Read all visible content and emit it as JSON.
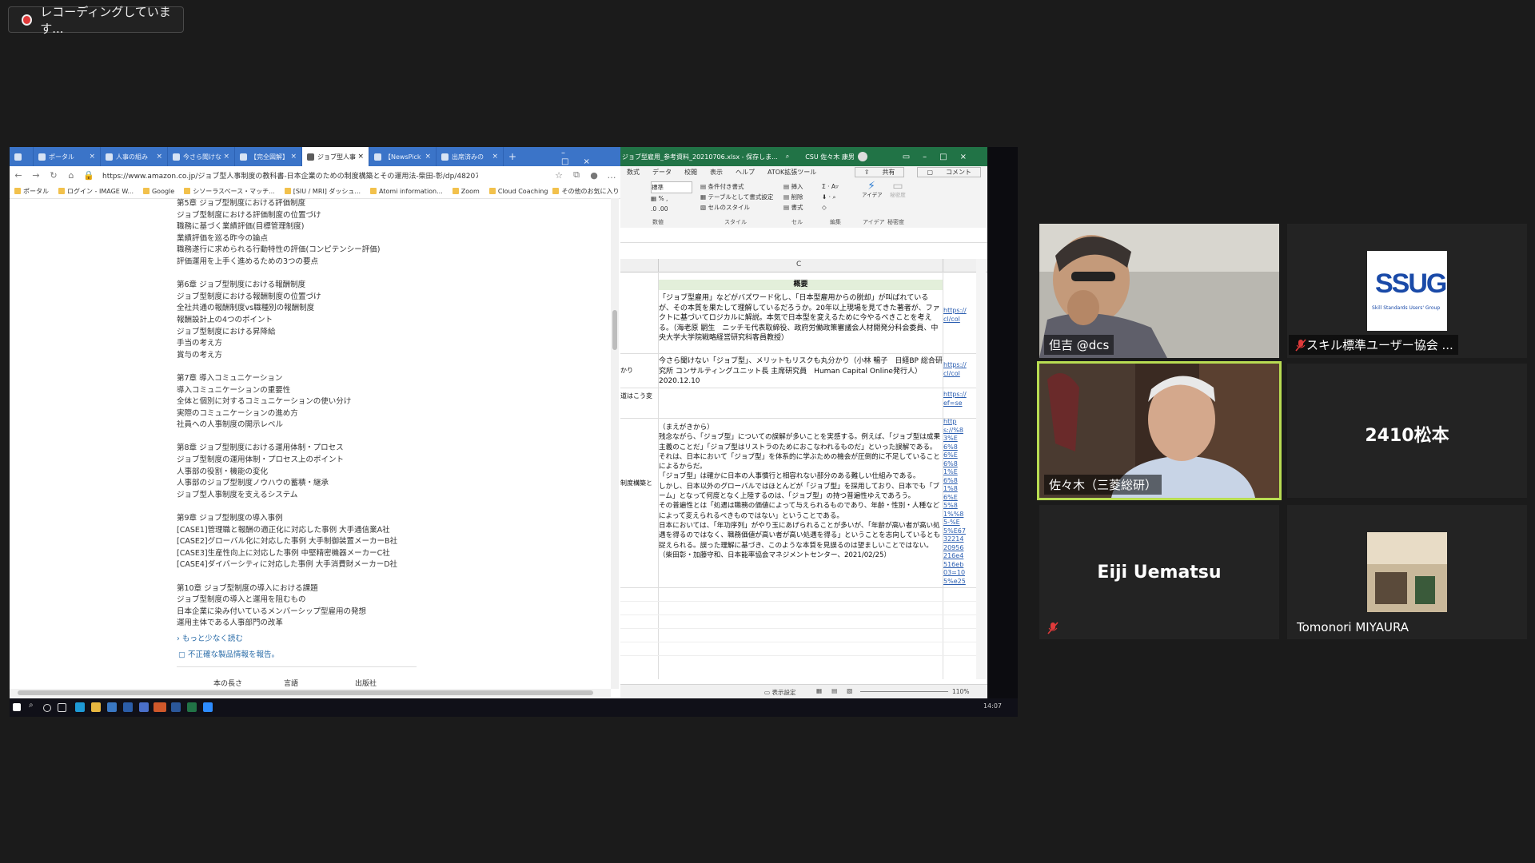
{
  "recording": {
    "label": "レコーディングしています..."
  },
  "browser": {
    "tabs": [
      "ポータル",
      "人事の組み",
      "今さら聞けな",
      "【完全図解】",
      "ジョブ型人事",
      "【NewsPick",
      "出席済みの"
    ],
    "url": "https://www.amazon.co.jp/ジョブ型人事制度の教科書-日本企業のための制度構築とその運用法-柴田-彰/dp/48207...",
    "bookmarks": [
      "ポータル",
      "ログイン - IMAGE W...",
      "Google",
      "シソーラスベース・マッチ...",
      "[SIU / MRI] ダッシュ...",
      "Atomi information...",
      "Zoom",
      "Cloud Coaching",
      "その他のお気に入り"
    ],
    "toc_lines": [
      "第5章 ジョブ型制度における評価制度",
      "ジョブ型制度における評価制度の位置づけ",
      "職務に基づく業績評価(目標管理制度)",
      "業績評価を巡る昨今の論点",
      "職務遂行に求められる行動特性の評価(コンピテンシー評価)",
      "評価運用を上手く進めるための3つの要点",
      "",
      "第6章 ジョブ型制度における報酬制度",
      "ジョブ型制度における報酬制度の位置づけ",
      "全社共通の報酬制度vs職種別の報酬制度",
      "報酬設計上の4つのポイント",
      "ジョブ型制度における昇降給",
      "手当の考え方",
      "賞与の考え方",
      "",
      "第7章 導入コミュニケーション",
      "導入コミュニケーションの重要性",
      "全体と個別に対するコミュニケーションの使い分け",
      "実際のコミュニケーションの進め方",
      "社員への人事制度の開示レベル",
      "",
      "第8章 ジョブ型制度における運用体制・プロセス",
      "ジョブ型制度の運用体制・プロセス上のポイント",
      "人事部の役割・機能の変化",
      "人事部のジョブ型制度ノウハウの蓄積・継承",
      "ジョブ型人事制度を支えるシステム",
      "",
      "第9章 ジョブ型制度の導入事例",
      "[CASE1]管理職と報酬の適正化に対応した事例 大手通信業A社",
      "[CASE2]グローバル化に対応した事例 大手制御装置メーカーB社",
      "[CASE3]生産性向上に対応した事例 中堅精密機器メーカーC社",
      "[CASE4]ダイバーシティに対応した事例 大手消費財メーカーD社",
      "",
      "第10章 ジョブ型制度の導入における課題",
      "ジョブ型制度の導入と運用を阻むもの",
      "日本企業に染み付いているメンバーシップ型雇用の発想",
      "運用主体である人事部門の改革"
    ],
    "read_less": "› もっと少なく読む",
    "report": "不正確な製品情報を報告。",
    "details_header": [
      "本の長さ",
      "言語",
      "出版社"
    ]
  },
  "excel": {
    "title": "ジョブ型雇用_参考資料_20210706.xlsx - 保存しま...",
    "user": "CSU 佐々木 康男",
    "menu": [
      "数式",
      "データ",
      "校閲",
      "表示",
      "ヘルプ",
      "ATOK拡張ツール"
    ],
    "share": "共有",
    "comment": "コメント",
    "ribbon": {
      "number_format": "標準",
      "style_items": [
        "条件付き書式",
        "テーブルとして書式設定",
        "セルのスタイル"
      ],
      "cell_items": [
        "挿入",
        "削除",
        "書式"
      ],
      "idea": "アイデア",
      "sensitivity": "秘密度",
      "groups": [
        "数値",
        "スタイル",
        "セル",
        "編集",
        "アイデア",
        "秘密度"
      ]
    },
    "column": "C",
    "header_cell": "概要",
    "cells": [
      "「ジョブ型雇用」などがバズワード化し、「日本型雇用からの脱却」が叫ばれているが、その本質を果たして理解しているだろうか。20年以上現場を見てきた著者が、ファクトに基づいてロジカルに解説。本気で日本型を変えるために今やるべきことを考える。（海老原 嗣生　ニッチモ代表取締役、政府労働政策審議会人材開発分科会委員、中央大学大学院戦略経営研究科客員教授）",
      "今さら聞けない「ジョブ型」、メリットもリスクも丸分かり（小林 暢子　日経BP 総合研究所 コンサルティングユニット長 主席研究員　Human Capital Online発行人）2020.12.10",
      "（まえがきから）\n残念ながら、「ジョブ型」についての誤解が多いことを実感する。例えば、「ジョブ型は成果主義のことだ」「ジョブ型はリストラのためにおこなわれるものだ」といった誤解である。それは、日本において「ジョブ型」を体系的に学ぶための機会が圧倒的に不足していることによるからだ。\n「ジョブ型」は確かに日本の人事慣行と相容れない部分のある難しい仕組みである。\nしかし、日本以外のグローバルではほとんどが「ジョブ型」を採用しており、日本でも「ブーム」となって何度となく上陸するのは、「ジョブ型」の持つ普遍性ゆえであろう。\nその普遍性とは「処遇は職務の価値によって与えられるものであり、年齢・性別・人種などによって変えられるべきものではない」ということである。\n日本においては、「年功序列」がやり玉にあげられることが多いが、「年齢が高い者が高い処遇を得るのではなく、職務価値が高い者が高い処遇を得る」ということを志向しているとも捉えられる。誤った理解に基づき、このような本質を見誤るのは望ましいことではない。（柴田彰・加藤守和、日本能率協会マネジメントセンター、2021/02/25）"
    ],
    "side_labels": [
      "かり",
      "道はこう変",
      "制度構築と"
    ],
    "links": [
      "https://cl/col",
      "https://cl/col",
      "https://ef=se",
      "https://%83%E6%86%E6%81%E6%81%86%E5%81%%85-%E5%E673221420956216e4516eb03=105%e25cece&ref="
    ],
    "status": {
      "display_settings": "表示設定",
      "zoom": "110%"
    }
  },
  "taskbar": {
    "clock": "14:07"
  },
  "participants": [
    {
      "name": "但吉 @dcs",
      "muted": false,
      "video": true
    },
    {
      "name": "スキル標準ユーザー協会 ...",
      "muted": true,
      "video": false,
      "logo": "SSUG",
      "logo_sub": "Skill Standards Users' Group"
    },
    {
      "name": "佐々木（三菱総研）",
      "muted": false,
      "video": true,
      "active": true
    },
    {
      "name": "2410松本",
      "muted": false,
      "video": false
    },
    {
      "name": "Eiji Uematsu",
      "muted": true,
      "video": false
    },
    {
      "name": "Tomonori MIYAURA",
      "muted": false,
      "video": false,
      "avatar": true
    }
  ],
  "colors": {
    "excel_green": "#217346",
    "browser_blue": "#3b74c8",
    "active_speaker": "#b8dc52",
    "mute_red": "#e03a3a"
  }
}
